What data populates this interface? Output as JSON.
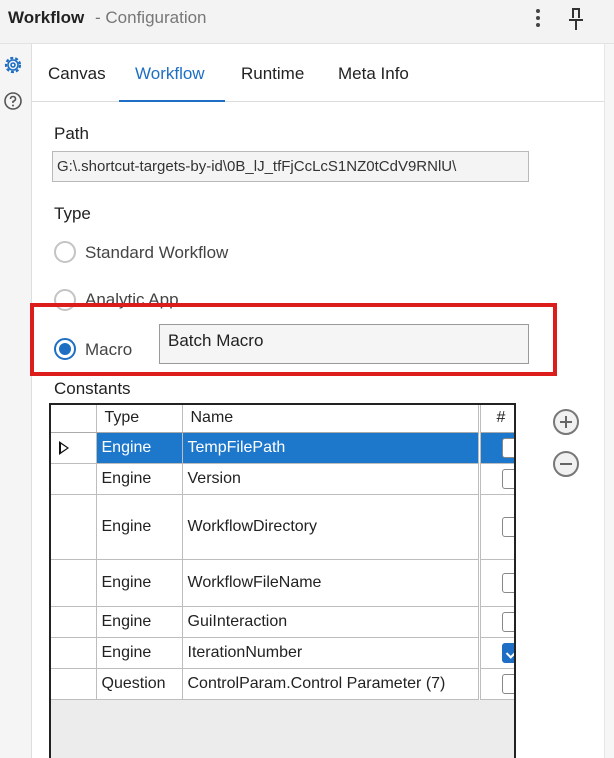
{
  "window": {
    "title": "Workflow",
    "subtitle": "- Configuration"
  },
  "tabs": [
    {
      "label": "Canvas"
    },
    {
      "label": "Workflow",
      "active": true
    },
    {
      "label": "Runtime"
    },
    {
      "label": "Meta Info"
    }
  ],
  "path": {
    "label": "Path",
    "value": "G:\\.shortcut-targets-by-id\\0B_lJ_tfFjCcLcS1NZ0tCdV9RNlU\\"
  },
  "type": {
    "label": "Type",
    "options": [
      {
        "label": "Standard Workflow",
        "selected": false
      },
      {
        "label": "Analytic App",
        "selected": false
      },
      {
        "label": "Macro",
        "selected": true
      }
    ],
    "macro_type_value": "Batch Macro"
  },
  "constants": {
    "label": "Constants",
    "headers": [
      "Type",
      "Name",
      "#"
    ],
    "rows": [
      {
        "type": "Engine",
        "name": "TempFilePath",
        "checked": false,
        "selected": true
      },
      {
        "type": "Engine",
        "name": "Version",
        "checked": false
      },
      {
        "type": "Engine",
        "name": "WorkflowDirectory",
        "checked": false
      },
      {
        "type": "Engine",
        "name": "WorkflowFileName",
        "checked": false
      },
      {
        "type": "Engine",
        "name": "GuiInteraction",
        "checked": false
      },
      {
        "type": "Engine",
        "name": "IterationNumber",
        "checked": true
      },
      {
        "type": "Question",
        "name": "ControlParam.Control Parameter (7)",
        "checked": false
      }
    ]
  },
  "icons": {
    "kebab": "more-vertical-icon",
    "pin": "pin-icon",
    "rail_top": "gear-icon",
    "rail_bottom": "help-icon",
    "add": "plus-circle-icon",
    "remove": "minus-circle-icon"
  },
  "colors": {
    "accent": "#1e6fc4",
    "selection": "#1d78cc",
    "highlight": "#dd1c1c"
  }
}
